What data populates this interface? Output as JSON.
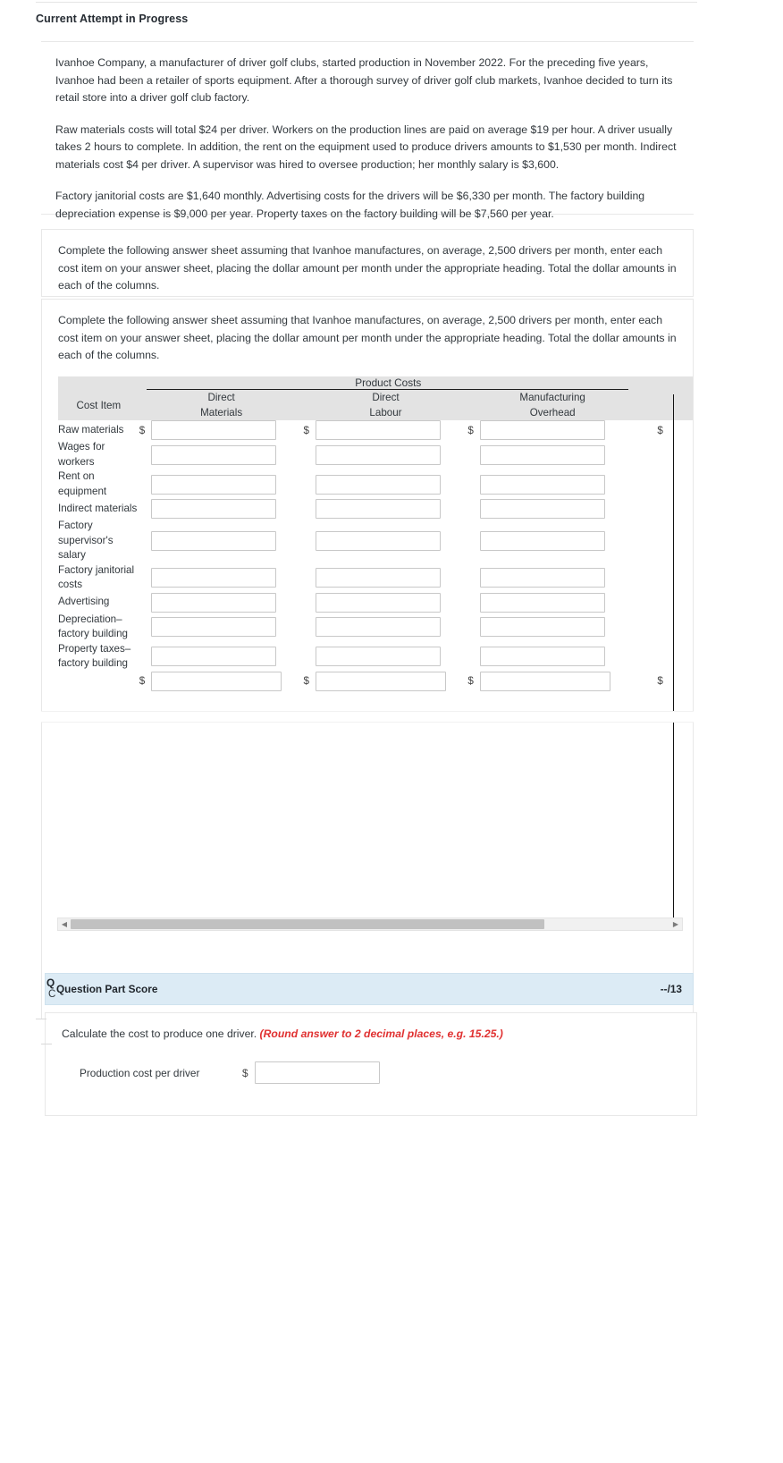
{
  "attempt": {
    "heading": "Current Attempt in Progress"
  },
  "problem": {
    "paragraphs": [
      "Ivanhoe Company, a manufacturer of driver golf clubs, started production in November 2022. For the preceding five years, Ivanhoe had been a retailer of sports equipment. After a thorough survey of driver golf club markets, Ivanhoe decided to turn its retail store into a driver golf club factory.",
      "Raw materials costs will total $24 per driver. Workers on the production lines are paid on average $19 per hour. A driver usually takes 2 hours to complete. In addition, the rent on the equipment used to produce drivers amounts to $1,530 per month. Indirect materials cost $4 per driver. A supervisor was hired to oversee production; her monthly salary is $3,600.",
      "Factory janitorial costs are $1,640 monthly. Advertising costs for the drivers will be $6,330 per month. The factory building depreciation expense is $9,000 per year. Property taxes on the factory building will be $7,560 per year."
    ]
  },
  "instructions": {
    "text_1": "Complete the following answer sheet assuming that Ivanhoe manufactures, on average, 2,500 drivers per month, enter each cost item on your answer sheet, placing the dollar amount per month under the appropriate heading. Total the dollar amounts in each of the columns.",
    "text_2": "Complete the following answer sheet assuming that Ivanhoe manufactures, on average, 2,500 drivers per month, enter each cost item on your answer sheet, placing the dollar amount per month under the appropriate heading. Total the dollar amounts in each of the columns."
  },
  "table": {
    "group_header": "Product Costs",
    "col_cost_item": "Cost Item",
    "columns": [
      {
        "line1": "Direct",
        "line2": "Materials"
      },
      {
        "line1": "Direct",
        "line2": "Labour"
      },
      {
        "line1": "Manufacturing",
        "line2": "Overhead"
      }
    ],
    "currency_symbol": "$",
    "rows": [
      {
        "label": "Raw materials",
        "show_dollar": true,
        "values": [
          "",
          "",
          ""
        ],
        "period_value": ""
      },
      {
        "label": "Wages for workers",
        "show_dollar": false,
        "values": [
          "",
          "",
          ""
        ],
        "period_value": ""
      },
      {
        "label": "Rent on equipment",
        "show_dollar": false,
        "values": [
          "",
          "",
          ""
        ],
        "period_value": ""
      },
      {
        "label": "Indirect materials",
        "show_dollar": false,
        "values": [
          "",
          "",
          ""
        ],
        "period_value": ""
      },
      {
        "label": "Factory supervisor's salary",
        "show_dollar": false,
        "values": [
          "",
          "",
          ""
        ],
        "period_value": ""
      },
      {
        "label": "Factory janitorial costs",
        "show_dollar": false,
        "values": [
          "",
          "",
          ""
        ],
        "period_value": ""
      },
      {
        "label": "Advertising",
        "show_dollar": false,
        "values": [
          "",
          "",
          ""
        ],
        "period_value": ""
      },
      {
        "label": "Depreciation–factory building",
        "show_dollar": false,
        "values": [
          "",
          "",
          ""
        ],
        "period_value": ""
      },
      {
        "label": "Property taxes–factory building",
        "show_dollar": false,
        "values": [
          "",
          "",
          ""
        ],
        "period_value": ""
      }
    ],
    "total_row": {
      "label": "",
      "show_dollar": true,
      "values": [
        "",
        "",
        ""
      ],
      "period_value": ""
    }
  },
  "scrollbar": {
    "left_arrow": "◀",
    "right_arrow": "▶"
  },
  "score": {
    "label": "Question Part Score",
    "value": "--/13",
    "clipped_q": "Q",
    "clipped_c": "C",
    "accent_color": "#dcebf5"
  },
  "final": {
    "prompt": "Calculate the cost to produce one driver. ",
    "note": "(Round answer to 2 decimal places, e.g. 15.25.)",
    "note_color": "#e03030",
    "row_label": "Production cost per driver",
    "currency_symbol": "$",
    "value": ""
  }
}
